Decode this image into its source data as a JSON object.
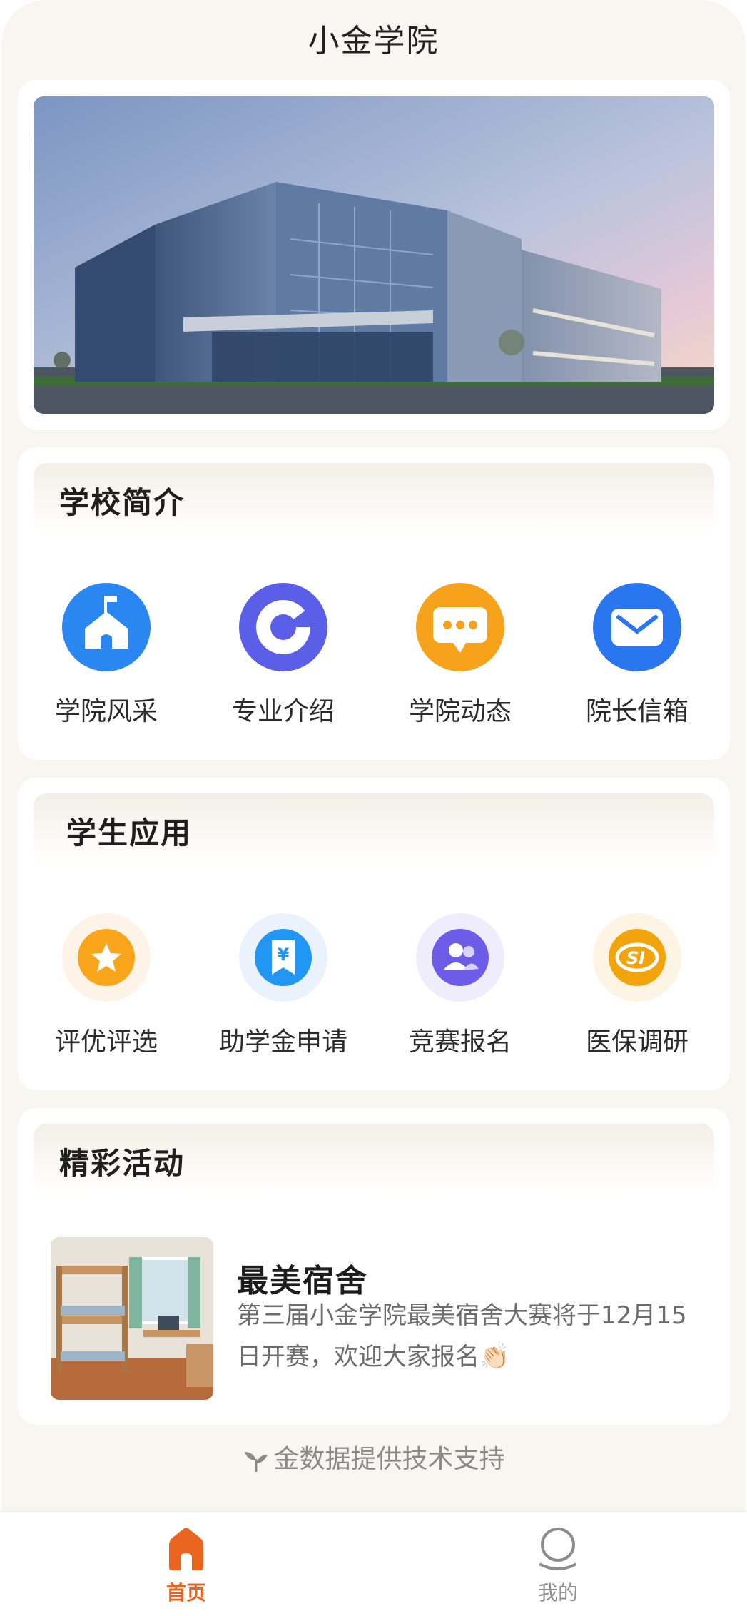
{
  "app": {
    "title": "小金学院"
  },
  "hero": {
    "image": "campus-building-photo"
  },
  "school_intro": {
    "title": "学校简介",
    "items": [
      {
        "label": "学院风采",
        "icon": "school-house-icon",
        "color": "#2a86f0"
      },
      {
        "label": "专业介绍",
        "icon": "c-ring-icon",
        "color": "#5b5ee6"
      },
      {
        "label": "学院动态",
        "icon": "chat-bubble-icon",
        "color": "#f7a21b"
      },
      {
        "label": "院长信箱",
        "icon": "mail-icon",
        "color": "#2a76ee"
      }
    ]
  },
  "student_apps": {
    "title": "学生应用",
    "items": [
      {
        "label": "评优评选",
        "icon": "star-icon",
        "color": "#f8a51c"
      },
      {
        "label": "助学金申请",
        "icon": "yuan-bookmark-icon",
        "color": "#2196f3"
      },
      {
        "label": "竞赛报名",
        "icon": "users-icon",
        "color": "#6c5ce7"
      },
      {
        "label": "医保调研",
        "icon": "si-logo-icon",
        "color": "#f2a40d"
      }
    ]
  },
  "activities": {
    "title": "精彩活动",
    "items": [
      {
        "title": "最美宿舍",
        "desc": "第三届小金学院最美宿舍大赛将于12月15日开赛，欢迎大家报名👏🏻",
        "image": "dormitory-photo"
      }
    ]
  },
  "footer": {
    "note": "金数据提供技术支持",
    "icon": "sprout-icon"
  },
  "tabbar": {
    "items": [
      {
        "label": "首页",
        "icon": "home-icon",
        "active": true
      },
      {
        "label": "我的",
        "icon": "user-icon",
        "active": false
      }
    ]
  },
  "colors": {
    "accent": "#e9651f",
    "background": "#f8f6f1",
    "inactive": "#8c8c8c"
  }
}
